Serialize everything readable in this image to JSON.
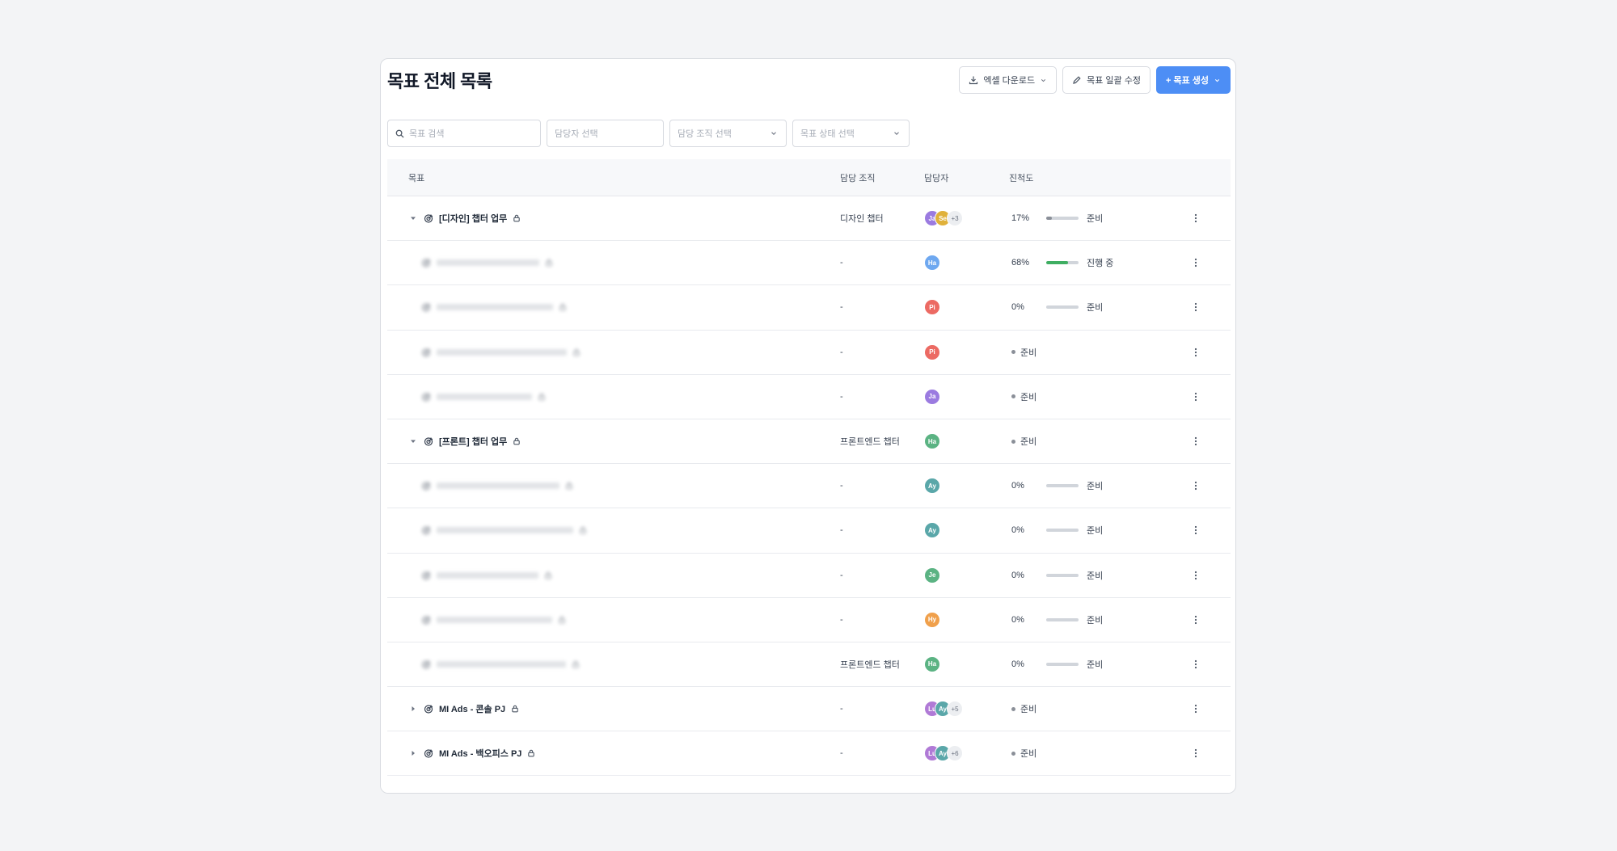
{
  "page": {
    "title": "목표 전체 목록",
    "buttons": {
      "excel": "엑셀 다운로드",
      "bulk_edit": "목표 일괄 수정",
      "create": "+ 목표 생성"
    }
  },
  "filters": {
    "search_placeholder": "목표 검색",
    "owner_placeholder": "담당자 선택",
    "org_placeholder": "담당 조직 선택",
    "status_placeholder": "목표 상태 선택"
  },
  "table": {
    "columns": {
      "goal": "목표",
      "org": "담당 조직",
      "owner": "담당자",
      "progress": "진척도"
    },
    "rows": [
      {
        "name": "[디자인] 챕터 업무",
        "level": 0,
        "toggle": "expanded",
        "org": "디자인 챕터",
        "avatars": [
          {
            "i": "Ja",
            "c": "#9b7be0"
          },
          {
            "i": "Se",
            "c": "#e0b13a"
          }
        ],
        "more": "+3",
        "progress": 17,
        "pct": "17%",
        "status": "준비",
        "bar_color": "#8a8f98"
      },
      {
        "name": "",
        "level": 1,
        "org": "-",
        "avatars": [
          {
            "i": "Ha",
            "c": "#6ea8f0"
          }
        ],
        "progress": 68,
        "pct": "68%",
        "status": "진행 중",
        "bar_color": "#3fae62"
      },
      {
        "name": "",
        "level": 1,
        "org": "-",
        "avatars": [
          {
            "i": "Pi",
            "c": "#ec6a63"
          }
        ],
        "progress": 0,
        "pct": "0%",
        "status": "준비",
        "bar_color": "#8a8f98"
      },
      {
        "name": "",
        "level": 1,
        "org": "-",
        "avatars": [
          {
            "i": "Pi",
            "c": "#ec6a63"
          }
        ],
        "pct": "",
        "status": "준비",
        "dot": true
      },
      {
        "name": "",
        "level": 1,
        "org": "-",
        "avatars": [
          {
            "i": "Ja",
            "c": "#9b7be0"
          }
        ],
        "pct": "",
        "status": "준비",
        "dot": true
      },
      {
        "name": "[프론트] 챕터 업무",
        "level": 0,
        "toggle": "expanded",
        "org": "프론트엔드 챕터",
        "avatars": [
          {
            "i": "Ha",
            "c": "#5bb383"
          }
        ],
        "pct": "",
        "status": "준비",
        "dot": true
      },
      {
        "name": "",
        "level": 1,
        "org": "-",
        "avatars": [
          {
            "i": "Ay",
            "c": "#5aa7a9"
          }
        ],
        "progress": 0,
        "pct": "0%",
        "status": "준비",
        "bar_color": "#8a8f98"
      },
      {
        "name": "",
        "level": 1,
        "org": "-",
        "avatars": [
          {
            "i": "Ay",
            "c": "#5aa7a9"
          }
        ],
        "progress": 0,
        "pct": "0%",
        "status": "준비",
        "bar_color": "#8a8f98"
      },
      {
        "name": "",
        "level": 1,
        "org": "-",
        "avatars": [
          {
            "i": "Je",
            "c": "#5bb383"
          }
        ],
        "progress": 0,
        "pct": "0%",
        "status": "준비",
        "bar_color": "#8a8f98"
      },
      {
        "name": "",
        "level": 1,
        "org": "-",
        "avatars": [
          {
            "i": "Hy",
            "c": "#f0a04b"
          }
        ],
        "progress": 0,
        "pct": "0%",
        "status": "준비",
        "bar_color": "#8a8f98"
      },
      {
        "name": "",
        "level": 1,
        "org": "프론트엔드 챕터",
        "avatars": [
          {
            "i": "Ha",
            "c": "#5bb383"
          }
        ],
        "progress": 0,
        "pct": "0%",
        "status": "준비",
        "bar_color": "#8a8f98"
      },
      {
        "name": "MI Ads - 콘솔 PJ",
        "level": 0,
        "toggle": "collapsed",
        "org": "-",
        "avatars": [
          {
            "i": "Lu",
            "c": "#b07ad6"
          },
          {
            "i": "Ay",
            "c": "#5aa7a9"
          }
        ],
        "more": "+5",
        "pct": "",
        "status": "준비",
        "dot": true
      },
      {
        "name": "MI Ads - 백오피스 PJ",
        "level": 0,
        "toggle": "collapsed",
        "org": "-",
        "avatars": [
          {
            "i": "Lu",
            "c": "#b07ad6"
          },
          {
            "i": "Ay",
            "c": "#5aa7a9"
          }
        ],
        "more": "+6",
        "pct": "",
        "status": "준비",
        "dot": true
      }
    ]
  },
  "colors": {
    "primary": "#4d8ef5",
    "border": "#d7dae0"
  }
}
